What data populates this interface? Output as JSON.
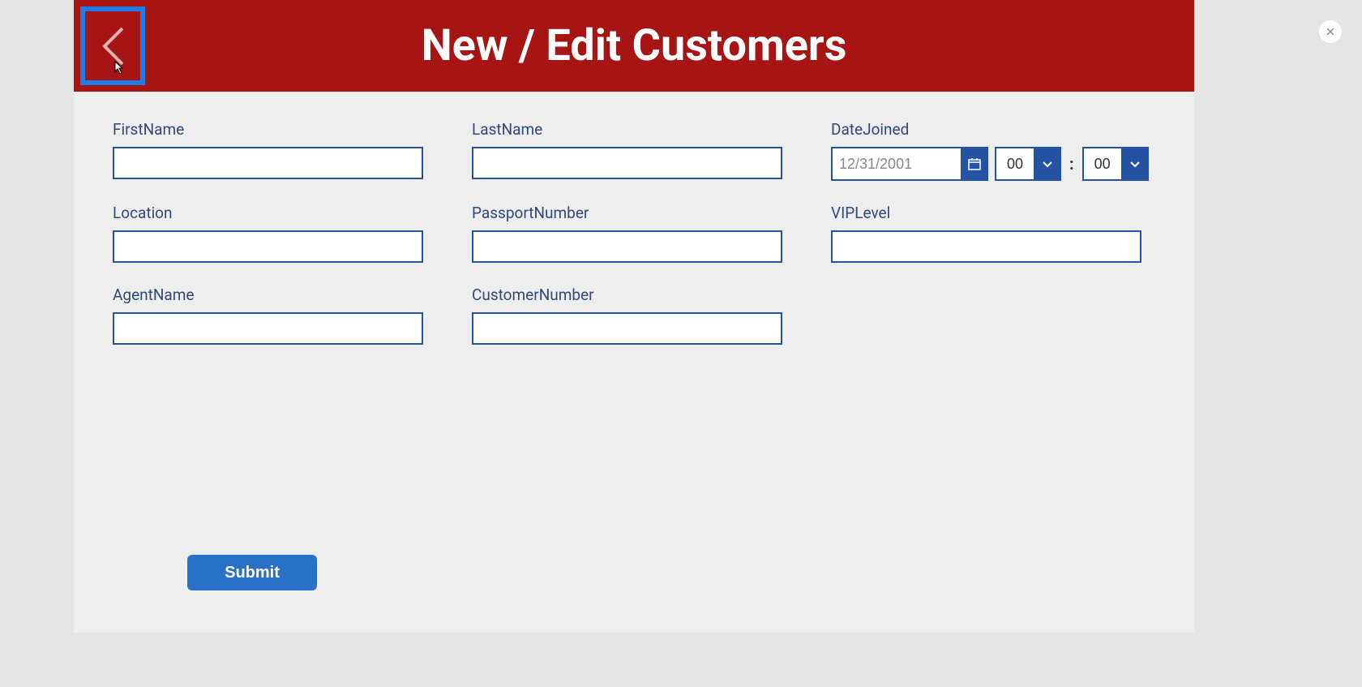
{
  "header": {
    "title": "New / Edit Customers"
  },
  "fields": {
    "firstName": {
      "label": "FirstName",
      "value": ""
    },
    "lastName": {
      "label": "LastName",
      "value": ""
    },
    "dateJoined": {
      "label": "DateJoined",
      "dateValue": "12/31/2001",
      "hour": "00",
      "minute": "00",
      "separator": ":"
    },
    "location": {
      "label": "Location",
      "value": ""
    },
    "passportNumber": {
      "label": "PassportNumber",
      "value": ""
    },
    "vipLevel": {
      "label": "VIPLevel",
      "value": ""
    },
    "agentName": {
      "label": "AgentName",
      "value": ""
    },
    "customerNumber": {
      "label": "CustomerNumber",
      "value": ""
    }
  },
  "buttons": {
    "submit": "Submit"
  }
}
